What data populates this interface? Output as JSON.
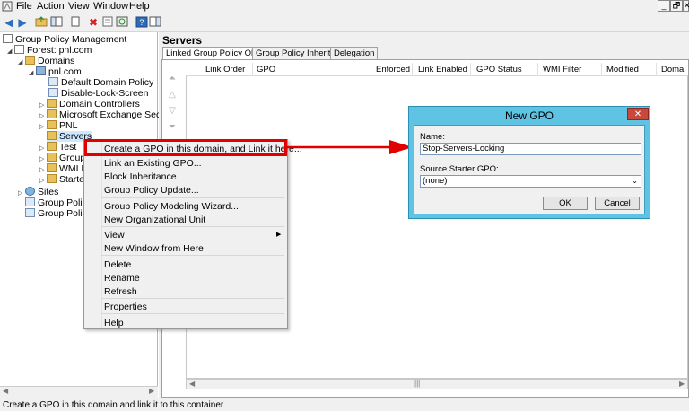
{
  "menubar": {
    "items": [
      "File",
      "Action",
      "View",
      "Window",
      "Help"
    ],
    "window_buttons": [
      "_",
      "🗗",
      "✕"
    ]
  },
  "tree": {
    "root": "Group Policy Management",
    "forest": "Forest: pnl.com",
    "domains": "Domains",
    "domain": "pnl.com",
    "items": [
      "Default Domain Policy",
      "Disable-Lock-Screen",
      "Domain Controllers",
      "Microsoft Exchange Security G",
      "PNL",
      "Servers",
      "Test",
      "Group",
      "WMI F",
      "Starter"
    ],
    "sites": "Sites",
    "gp_modeling": "Group Policy",
    "gp_results": "Group Policy"
  },
  "pane": {
    "title": "Servers",
    "tabs": [
      "Linked Group Policy Objects",
      "Group Policy Inheritance",
      "Delegation"
    ],
    "columns": [
      "Link Order",
      "GPO",
      "Enforced",
      "Link Enabled",
      "GPO Status",
      "WMI Filter",
      "Modified",
      "Doma"
    ]
  },
  "context_menu": {
    "items": [
      "Create a GPO in this domain, and Link it here...",
      "Link an Existing GPO...",
      "Block Inheritance",
      "Group Policy Update...",
      "Group Policy Modeling Wizard...",
      "New Organizational Unit",
      "View",
      "New Window from Here",
      "Delete",
      "Rename",
      "Refresh",
      "Properties",
      "Help"
    ]
  },
  "dialog": {
    "title": "New GPO",
    "name_label": "Name:",
    "name_value": "Stop-Servers-Locking",
    "starter_label": "Source Starter GPO:",
    "starter_value": "(none)",
    "ok": "OK",
    "cancel": "Cancel"
  },
  "status": "Create a GPO in this domain and link it to this container",
  "colors": {
    "highlight": "#e00000",
    "dialog_frame": "#5fc3e4",
    "close_button": "#c9473b"
  }
}
